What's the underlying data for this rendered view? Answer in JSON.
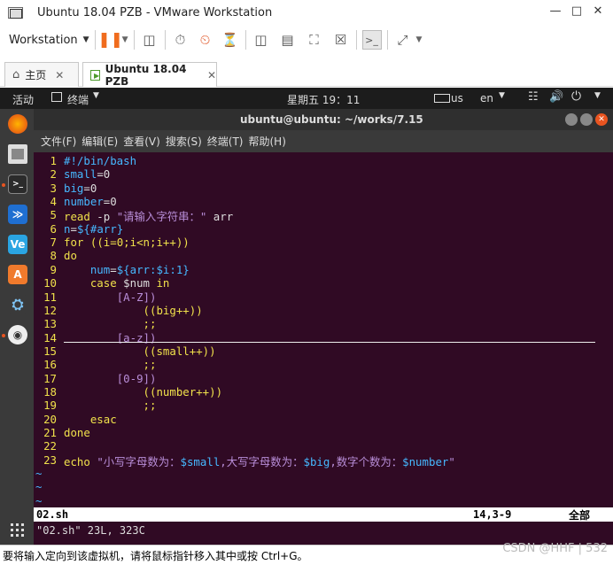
{
  "window": {
    "title": "Ubuntu 18.04 PZB - VMware Workstation"
  },
  "toolbar": {
    "workstation_label": "Workstation"
  },
  "tabs": [
    {
      "label": "主页"
    },
    {
      "label": "Ubuntu 18.04 PZB"
    }
  ],
  "gnome": {
    "activities": "活动",
    "app_menu": "终端",
    "clock": "星期五 19：11",
    "keyboard": "us",
    "lang": "en"
  },
  "terminal": {
    "title": "ubuntu@ubuntu: ~/works/7.15",
    "menu": [
      "文件(F)",
      "编辑(E)",
      "查看(V)",
      "搜索(S)",
      "终端(T)",
      "帮助(H)"
    ]
  },
  "editor": {
    "line_numbers": [
      "1",
      "2",
      "3",
      "4",
      "5",
      "6",
      "7",
      "8",
      "9",
      "10",
      "11",
      "12",
      "13",
      "14",
      "15",
      "16",
      "17",
      "18",
      "19",
      "20",
      "21",
      "22",
      "23"
    ],
    "lines": [
      "#!/bin/bash",
      "small=0",
      "big=0",
      "number=0",
      "read -p \"请输入字符串：\" arr",
      "n=${#arr}",
      "for ((i=0;i<n;i++))",
      "do",
      "    num=${arr:$i:1}",
      "    case $num in",
      "        [A-Z])",
      "            ((big++))",
      "            ;;",
      "        [a-z])",
      "            ((small++))",
      "            ;;",
      "        [0-9])",
      "            ((number++))",
      "            ;;",
      "    esac",
      "done",
      "",
      "echo \"小写字母数为：$small,大写字母数为：$big,数字个数为：$number\""
    ],
    "status_file": "02.sh",
    "status_pos": "14,3-9",
    "status_all": "全部",
    "cmdline": "\"02.sh\" 23L, 323C",
    "tilde": "~"
  },
  "bottom": {
    "message": "要将输入定向到该虚拟机，请将鼠标指针移入其中或按 Ctrl+G。",
    "watermark": "CSDN @HHF | 532"
  },
  "colors": {
    "terminal_bg": "#300a24",
    "linenum": "#f0e14b",
    "var": "#46b8ff",
    "string": "#b88dd8"
  }
}
